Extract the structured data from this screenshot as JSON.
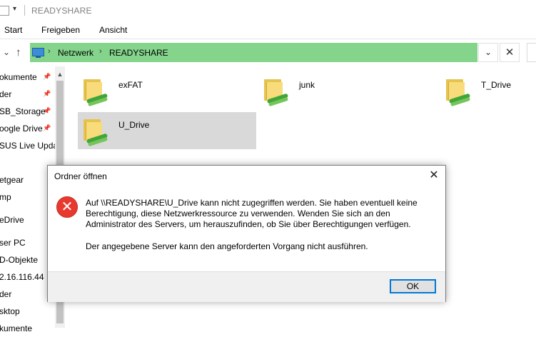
{
  "window": {
    "title": "READYSHARE",
    "qa_chevron": "▾"
  },
  "ribbon": {
    "tabs": [
      "Start",
      "Freigeben",
      "Ansicht"
    ]
  },
  "nav": {
    "back": "‹",
    "forward": "⌄",
    "up": "↑",
    "breadcrumb": [
      "Netzwerk",
      "READYSHARE"
    ],
    "crumb_separator": "›",
    "dropdown": "⌄",
    "clear": "✕"
  },
  "sidebar": {
    "items": [
      {
        "label": "okumente",
        "pinned": true
      },
      {
        "label": "der",
        "pinned": true
      },
      {
        "label": "SB_Storage",
        "pinned": true
      },
      {
        "label": "oogle Drive",
        "pinned": true
      },
      {
        "label": "SUS Live Updat",
        "pinned": false
      },
      {
        "label": "",
        "pinned": false
      },
      {
        "label": "etgear",
        "pinned": false
      },
      {
        "label": "mp",
        "pinned": false
      },
      {
        "label": "eDrive",
        "pinned": false
      },
      {
        "label": "ser PC",
        "pinned": false
      },
      {
        "label": "D-Objekte",
        "pinned": false
      },
      {
        "label": "2.16.116.44",
        "pinned": false
      },
      {
        "label": "der",
        "pinned": false
      },
      {
        "label": "sktop",
        "pinned": false
      },
      {
        "label": "kumente",
        "pinned": false
      }
    ],
    "pin_icon": "📌",
    "scroll_up": "▲"
  },
  "folders": [
    {
      "name": "exFAT",
      "selected": false
    },
    {
      "name": "junk",
      "selected": false
    },
    {
      "name": "T_Drive",
      "selected": false
    },
    {
      "name": "U_Drive",
      "selected": true
    }
  ],
  "dialog": {
    "title": "Ordner öffnen",
    "close": "✕",
    "icon": "✕",
    "message": "Auf \\\\READYSHARE\\U_Drive kann nicht zugegriffen werden. Sie haben eventuell keine Berechtigung, diese Netzwerkressource zu verwenden. Wenden Sie sich an den Administrator des Servers, um herauszufinden, ob Sie über Berechtigungen verfügen.",
    "detail": "Der angegebene Server kann den angeforderten Vorgang nicht ausführen.",
    "ok_label": "OK"
  },
  "colors": {
    "address_bar": "#84d48c",
    "selection": "#d9d9d9",
    "error": "#e8392f",
    "focus_border": "#0078d7"
  }
}
